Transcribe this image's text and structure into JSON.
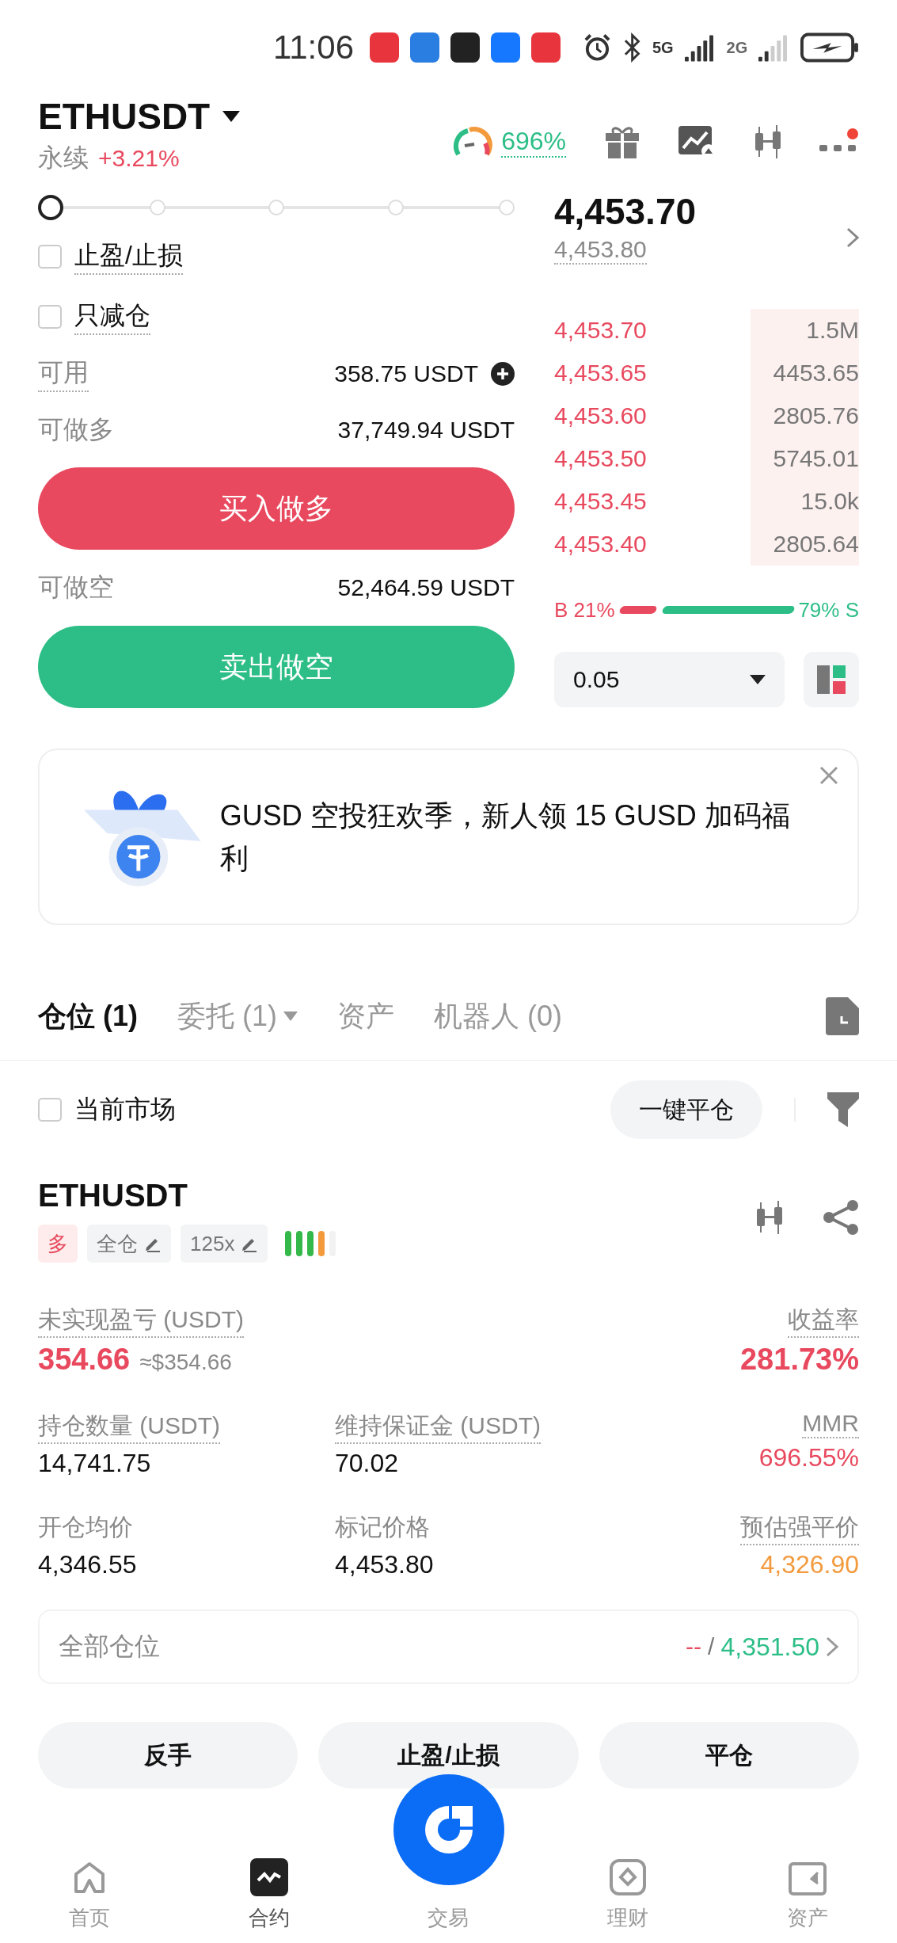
{
  "status_bar": {
    "time": "11:06",
    "networks": [
      "5G",
      "2G"
    ]
  },
  "header": {
    "symbol": "ETHUSDT",
    "contract_type": "永续",
    "change": "+3.21%",
    "risk": "696%",
    "notification": true
  },
  "leverage_slider": {
    "level": 0
  },
  "options": [
    {
      "label": "止盈/止损",
      "checked": false
    },
    {
      "label": "只减仓",
      "checked": false
    }
  ],
  "balances": [
    {
      "label": "可用",
      "value": "358.75 USDT",
      "underlined": true,
      "add": true
    },
    {
      "label": "可做多",
      "value": "37,749.94 USDT",
      "underlined": false,
      "add": false
    }
  ],
  "buy_button": "买入做多",
  "short_balance": {
    "label": "可做空",
    "value": "52,464.59 USDT"
  },
  "sell_button": "卖出做空",
  "order_book": {
    "last_price": "4,453.70",
    "mark_price": "4,453.80",
    "asks": [
      {
        "price": "4,453.70",
        "amount": "1.5M"
      },
      {
        "price": "4,453.65",
        "amount": "4453.65"
      },
      {
        "price": "4,453.60",
        "amount": "2805.76"
      },
      {
        "price": "4,453.50",
        "amount": "5745.01"
      },
      {
        "price": "4,453.45",
        "amount": "15.0k"
      },
      {
        "price": "4,453.40",
        "amount": "2805.64"
      }
    ],
    "ratio": {
      "buy_label": "B 21%",
      "sell_label": "79% S",
      "level": 0.21
    },
    "precision": "0.05"
  },
  "banner": {
    "text": "GUSD 空投狂欢季，新人领 15 GUSD 加码福利"
  },
  "tabs": [
    {
      "label": "仓位 (1)",
      "selected": true,
      "menu": false
    },
    {
      "label": "委托 (1)",
      "selected": false,
      "menu": true
    },
    {
      "label": "资产",
      "selected": false,
      "menu": false
    },
    {
      "label": "机器人 (0)",
      "selected": false,
      "menu": false
    }
  ],
  "filter": {
    "label": "当前市场",
    "checked": false,
    "close_all": "一键平仓"
  },
  "position": {
    "symbol": "ETHUSDT",
    "tags": [
      {
        "kind": "side",
        "text": "多"
      },
      {
        "kind": "edit",
        "text": "全仓"
      },
      {
        "kind": "edit",
        "text": "125x"
      }
    ],
    "risk": {
      "level": 0.8
    },
    "metrics": [
      [
        {
          "label": "未实现盈亏 (USDT)",
          "value": "354.66",
          "approx": "≈$354.66",
          "color": "#e8495e",
          "big": true
        },
        {
          "label": "收益率",
          "value": "281.73%",
          "color": "#e8495e",
          "big": true
        }
      ],
      [
        {
          "label": "持仓数量 (USDT)",
          "value": "14,741.75",
          "color": "#111111",
          "big": false
        },
        {
          "label": "维持保证金 (USDT)",
          "value": "70.02",
          "color": "#111111",
          "big": false
        },
        {
          "label": "MMR",
          "value": "696.55%",
          "color": "#e8495e",
          "big": false
        }
      ],
      [
        {
          "label": "开仓均价",
          "value": "4,346.55",
          "color": "#111111",
          "big": false,
          "plain": true
        },
        {
          "label": "标记价格",
          "value": "4,453.80",
          "color": "#111111",
          "big": false,
          "plain": true
        },
        {
          "label": "预估强平价",
          "value": "4,326.90",
          "color": "#f39a3d",
          "big": false
        }
      ]
    ]
  },
  "all_positions": {
    "label": "全部仓位",
    "loss": "--",
    "separator": "/",
    "profit": "4,351.50"
  },
  "actions": [
    "反手",
    "止盈/止损",
    "平仓"
  ],
  "nav": [
    {
      "label": "首页",
      "kind": "home",
      "selected": false
    },
    {
      "label": "合约",
      "kind": "futures",
      "selected": true
    },
    {
      "label": "交易",
      "kind": "trade",
      "selected": false
    },
    {
      "label": "理财",
      "kind": "earn",
      "selected": false
    },
    {
      "label": "资产",
      "kind": "assets",
      "selected": false
    }
  ]
}
